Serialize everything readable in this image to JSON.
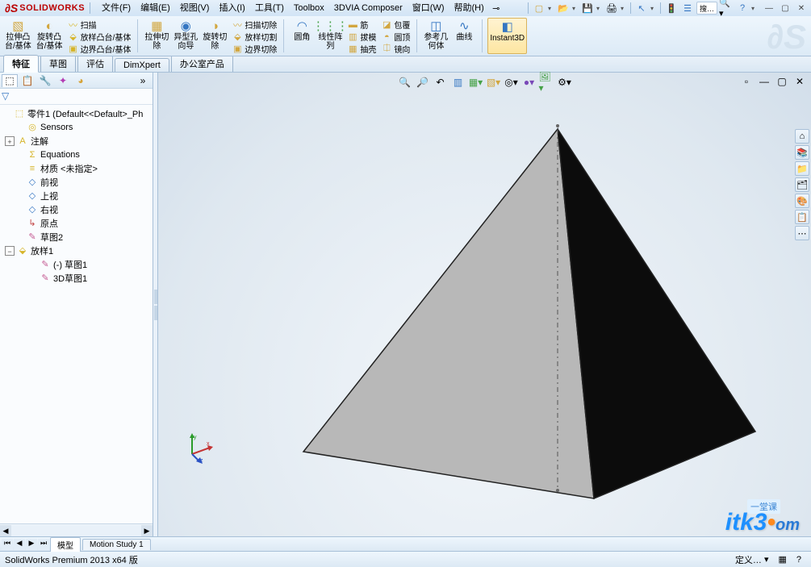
{
  "app": {
    "logo": "SOLIDWORKS",
    "ds_short": "DS"
  },
  "menus": [
    "文件(F)",
    "编辑(E)",
    "视图(V)",
    "插入(I)",
    "工具(T)",
    "Toolbox",
    "3DVIA Composer",
    "窗口(W)",
    "帮助(H)"
  ],
  "quick_tools": [
    "new",
    "open",
    "save",
    "print",
    "undo",
    "redo",
    "select",
    "rebuild",
    "options",
    "search",
    "help"
  ],
  "search_text": "搜…",
  "ribbon_groups": {
    "g1": [
      {
        "icon": "◧",
        "label": "拉伸凸\n台/基体"
      },
      {
        "icon": "◐",
        "label": "旋转凸\n台/基体"
      }
    ],
    "g1b": [
      {
        "icon": "〰",
        "label": "扫描"
      },
      {
        "icon": "⬙",
        "label": "放样凸台/基体"
      },
      {
        "icon": "▣",
        "label": "边界凸台/基体"
      }
    ],
    "g2": [
      {
        "icon": "▦",
        "label": "拉伸切\n除"
      },
      {
        "icon": "◉",
        "label": "异型孔\n向导"
      },
      {
        "icon": "◑",
        "label": "旋转切\n除"
      }
    ],
    "g2b": [
      {
        "icon": "〰",
        "label": "扫描切除"
      },
      {
        "icon": "⬙",
        "label": "放样切割"
      },
      {
        "icon": "▣",
        "label": "边界切除"
      }
    ],
    "g3": [
      {
        "icon": "◠",
        "label": "圆角"
      },
      {
        "icon": "⋮⋮⋮",
        "label": "线性阵\n列"
      },
      {
        "icon": "▥",
        "label": "拔模"
      },
      {
        "icon": "▦",
        "label": "圆顶"
      }
    ],
    "g3b": [
      {
        "icon": "▬",
        "label": "筋"
      },
      {
        "icon": "▥",
        "label": "抽壳"
      },
      {
        "icon": "◪",
        "label": "包覆"
      },
      {
        "icon": "⎅",
        "label": "镜向"
      }
    ],
    "g4": [
      {
        "icon": "◫",
        "label": "参考几\n何体"
      },
      {
        "icon": "∿",
        "label": "曲线"
      }
    ],
    "g5": [
      {
        "icon": "◧",
        "label": "Instant3D"
      }
    ]
  },
  "tabs": [
    "特征",
    "草图",
    "评估",
    "DimXpert",
    "办公室产品"
  ],
  "active_tab": "特征",
  "tree_tabs": [
    "part",
    "config",
    "display",
    "appear"
  ],
  "tree_root": "零件1  (Default<<Default>_Ph",
  "tree_nodes": [
    {
      "indent": 0,
      "exp": "",
      "icon": "⬚",
      "color": "ic-y",
      "label": "零件1  (Default<<Default>_Ph"
    },
    {
      "indent": 1,
      "exp": "",
      "icon": "◎",
      "color": "ic-y",
      "label": "Sensors"
    },
    {
      "indent": 1,
      "exp": "+",
      "icon": "A",
      "color": "ic-y",
      "label": "注解"
    },
    {
      "indent": 1,
      "exp": "",
      "icon": "Σ",
      "color": "ic-y",
      "label": "Equations"
    },
    {
      "indent": 1,
      "exp": "",
      "icon": "≡",
      "color": "ic-y",
      "label": "材质 <未指定>"
    },
    {
      "indent": 1,
      "exp": "",
      "icon": "◇",
      "color": "ic-blue",
      "label": "前视"
    },
    {
      "indent": 1,
      "exp": "",
      "icon": "◇",
      "color": "ic-blue",
      "label": "上视"
    },
    {
      "indent": 1,
      "exp": "",
      "icon": "◇",
      "color": "ic-blue",
      "label": "右视"
    },
    {
      "indent": 1,
      "exp": "",
      "icon": "↳",
      "color": "ic-red",
      "label": "原点"
    },
    {
      "indent": 1,
      "exp": "",
      "icon": "✎",
      "color": "ic-pink",
      "label": "草图2"
    },
    {
      "indent": 1,
      "exp": "−",
      "icon": "⬙",
      "color": "ic-y",
      "label": "放样1"
    },
    {
      "indent": 2,
      "exp": "",
      "icon": "✎",
      "color": "ic-pink",
      "label": "(-) 草图1"
    },
    {
      "indent": 2,
      "exp": "",
      "icon": "✎",
      "color": "ic-pink",
      "label": "3D草图1"
    }
  ],
  "view_toolbar": [
    "zoom-fit",
    "zoom-area",
    "prev-view",
    "section",
    "display-style",
    "hide-show",
    "edit-appearance",
    "apply-scene",
    "view-settings"
  ],
  "bottom_tabs": [
    "模型",
    "Motion Study 1"
  ],
  "status_left": "SolidWorks Premium 2013 x64 版",
  "status_right": [
    "定义…",
    "?"
  ],
  "watermark": "itk3",
  "watermark_suffix": "om",
  "watermark_sub": "一堂课"
}
